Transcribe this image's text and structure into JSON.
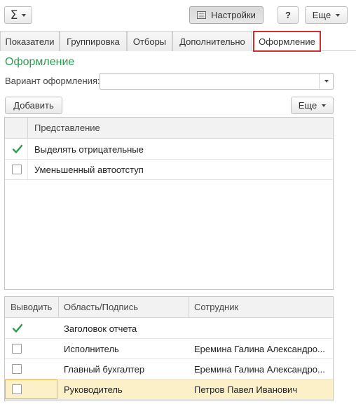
{
  "toolbar": {
    "sigma_symbol": "Σ",
    "settings_label": "Настройки",
    "help_label": "?",
    "more_label": "Еще"
  },
  "tabs": [
    {
      "label": "Показатели",
      "active": false
    },
    {
      "label": "Группировка",
      "active": false
    },
    {
      "label": "Отборы",
      "active": false
    },
    {
      "label": "Дополнительно",
      "active": false
    },
    {
      "label": "Оформление",
      "active": true
    }
  ],
  "section": {
    "title": "Оформление",
    "variant_label": "Вариант оформления:",
    "variant_value": "",
    "add_label": "Добавить",
    "more_label": "Еще"
  },
  "appearance_table": {
    "header": "Представление",
    "rows": [
      {
        "checked": true,
        "label": "Выделять отрицательные"
      },
      {
        "checked": false,
        "label": "Уменьшенный автоотступ"
      }
    ]
  },
  "output_table": {
    "columns": [
      "Выводить",
      "Область/Подпись",
      "Сотрудник"
    ],
    "rows": [
      {
        "checked": true,
        "area": "Заголовок отчета",
        "employee": ""
      },
      {
        "checked": false,
        "area": "Исполнитель",
        "employee": "Еремина Галина Александро..."
      },
      {
        "checked": false,
        "area": "Главный бухгалтер",
        "employee": "Еремина Галина Александро..."
      },
      {
        "checked": false,
        "area": "Руководитель",
        "employee": "Петров Павел Иванович",
        "selected": true
      }
    ]
  },
  "colors": {
    "accent_green": "#2e9b4f",
    "active_tab_border": "#d32f2f",
    "selected_row": "#fbf0c8"
  },
  "icons": {
    "sigma": "sigma-icon",
    "settings": "settings-list-icon",
    "check": "checkmark-icon",
    "dropdown": "chevron-down-icon"
  }
}
